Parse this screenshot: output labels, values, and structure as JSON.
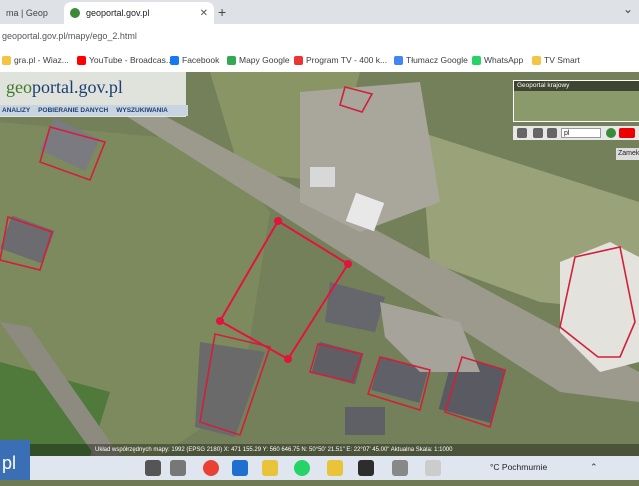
{
  "browser": {
    "tab_inactive_title": "ma | Geop",
    "tab_active_title": "geoportal.gov.pl",
    "new_tab_label": "+",
    "url": "geoportal.gov.pl/mapy/ego_2.html",
    "window_controls": "⌄",
    "bookmarks": [
      {
        "label": "gra.pl - Wiaz...",
        "icon": "folder-icon",
        "color": "#f4c542"
      },
      {
        "label": "YouTube - Broadcas...",
        "icon": "youtube-icon",
        "color": "#ff0000"
      },
      {
        "label": "Facebook",
        "icon": "facebook-icon",
        "color": "#1877f2"
      },
      {
        "label": "Mapy Google",
        "icon": "maps-icon",
        "color": "#34a853"
      },
      {
        "label": "Program TV - 400 k...",
        "icon": "tv-icon",
        "color": "#e33"
      },
      {
        "label": "Tłumacz Google",
        "icon": "translate-icon",
        "color": "#4285f4"
      },
      {
        "label": "WhatsApp",
        "icon": "whatsapp-icon",
        "color": "#25d366"
      },
      {
        "label": "TV Smart",
        "icon": "tv-smart-icon",
        "color": "#f4c542"
      }
    ]
  },
  "geoportal": {
    "logo_geo": "geo",
    "logo_rest": "portal.gov.pl",
    "menu": [
      "ANALIZY",
      "POBIERANIE DANYCH",
      "WYSZUKIWANIA"
    ],
    "overview_caption": "Geoportal krajowy",
    "scale_select": "pl",
    "zoom_button": "Zamek",
    "status_text": "Układ współrzędnych mapy: 1992 (EPSG 2180)   X: 471 155.29  Y: 560 646.75   N: 50°50' 21.51\"  E: 22°07' 45.00\"   Aktualna Skala: 1:1000"
  },
  "taskbar": {
    "corner_label": "pl",
    "weather": "°C  Pochmurnie",
    "tray": "⌃"
  }
}
